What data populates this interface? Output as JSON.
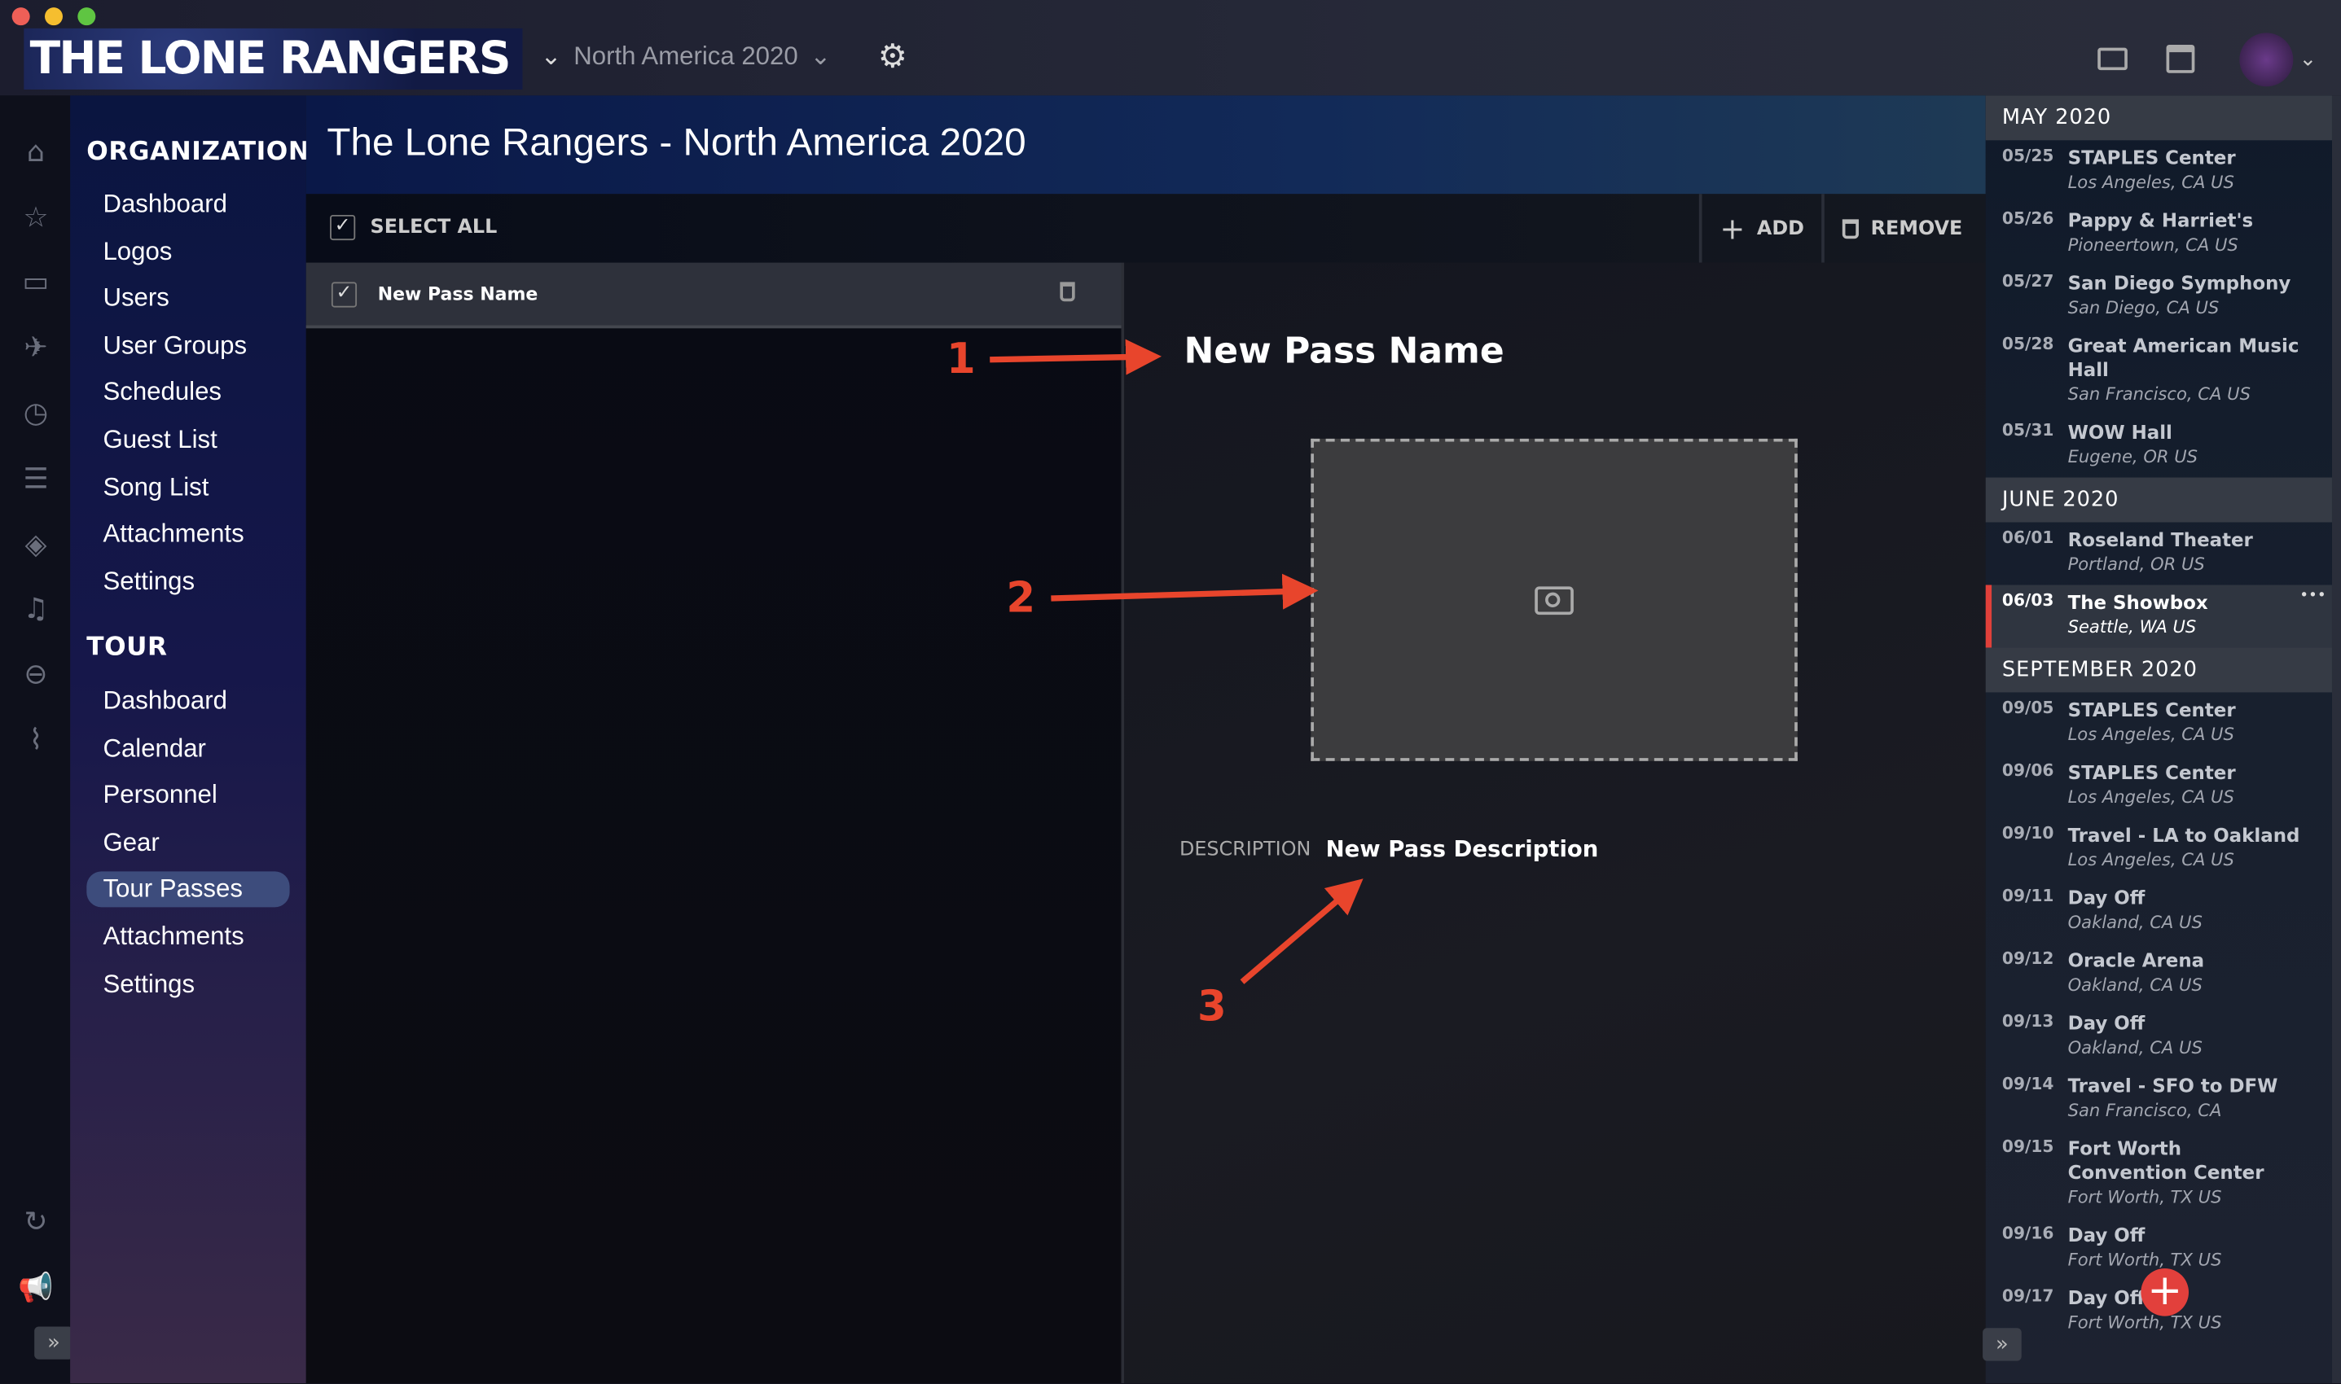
{
  "window": {
    "controls": [
      "close",
      "minimize",
      "zoom"
    ]
  },
  "topbar": {
    "logo_text": "THE LONE RANGERS",
    "tour_selector": "North America 2020",
    "icons": [
      "chevron-down-icon",
      "gear-icon",
      "contact-card-icon",
      "calendar-icon",
      "avatar"
    ]
  },
  "rail": {
    "icons": [
      "home-icon",
      "star-icon",
      "briefcase-icon",
      "plane-icon",
      "clock-icon",
      "list-icon",
      "ticket-icon",
      "music-icon",
      "piggy-bank-icon",
      "paperclip-icon",
      "sync-icon",
      "megaphone-icon"
    ],
    "expand": "»"
  },
  "nav": {
    "organization_heading": "ORGANIZATION",
    "organization": [
      {
        "label": "Dashboard"
      },
      {
        "label": "Logos"
      },
      {
        "label": "Users"
      },
      {
        "label": "User Groups"
      },
      {
        "label": "Schedules"
      },
      {
        "label": "Guest List"
      },
      {
        "label": "Song List"
      },
      {
        "label": "Attachments"
      },
      {
        "label": "Settings"
      }
    ],
    "tour_heading": "TOUR",
    "tour": [
      {
        "label": "Dashboard"
      },
      {
        "label": "Calendar"
      },
      {
        "label": "Personnel"
      },
      {
        "label": "Gear"
      },
      {
        "label": "Tour Passes",
        "selected": true
      },
      {
        "label": "Attachments"
      },
      {
        "label": "Settings"
      }
    ]
  },
  "header": {
    "title": "The Lone Rangers - North America 2020"
  },
  "toolbar": {
    "select_all": "SELECT ALL",
    "add": "ADD",
    "remove": "REMOVE",
    "select_all_checked": true
  },
  "passes": [
    {
      "name": "New Pass Name",
      "checked": true
    }
  ],
  "detail": {
    "name": "New Pass Name",
    "description_label": "DESCRIPTION",
    "description": "New Pass Description"
  },
  "annotations": {
    "color": "#e8452c",
    "labels": [
      "1",
      "2",
      "3"
    ]
  },
  "schedule": {
    "accent": "#e0403a",
    "months": [
      {
        "label": "MAY 2020",
        "events": [
          {
            "date": "05/25",
            "name": "STAPLES Center",
            "location": "Los Angeles, CA US"
          },
          {
            "date": "05/26",
            "name": "Pappy & Harriet's",
            "location": "Pioneertown, CA US"
          },
          {
            "date": "05/27",
            "name": "San Diego Symphony",
            "location": "San Diego, CA US"
          },
          {
            "date": "05/28",
            "name": "Great American Music Hall",
            "location": "San Francisco, CA US"
          },
          {
            "date": "05/31",
            "name": "WOW Hall",
            "location": "Eugene, OR US"
          }
        ]
      },
      {
        "label": "JUNE 2020",
        "events": [
          {
            "date": "06/01",
            "name": "Roseland Theater",
            "location": "Portland, OR US"
          },
          {
            "date": "06/03",
            "name": "The Showbox",
            "location": "Seattle, WA US",
            "selected": true,
            "more": "•••"
          }
        ]
      },
      {
        "label": "SEPTEMBER 2020",
        "events": [
          {
            "date": "09/05",
            "name": "STAPLES Center",
            "location": "Los Angeles, CA US"
          },
          {
            "date": "09/06",
            "name": "STAPLES Center",
            "location": "Los Angeles, CA US"
          },
          {
            "date": "09/10",
            "name": "Travel - LA to Oakland",
            "location": "Los Angeles, CA US"
          },
          {
            "date": "09/11",
            "name": "Day Off",
            "location": "Oakland, CA US"
          },
          {
            "date": "09/12",
            "name": "Oracle Arena",
            "location": "Oakland, CA US"
          },
          {
            "date": "09/13",
            "name": "Day Off",
            "location": "Oakland, CA US"
          },
          {
            "date": "09/14",
            "name": "Travel - SFO to DFW",
            "location": "San Francisco, CA"
          },
          {
            "date": "09/15",
            "name": "Fort Worth Convention Center",
            "location": "Fort Worth, TX US"
          },
          {
            "date": "09/16",
            "name": "Day Off",
            "location": "Fort Worth, TX US"
          },
          {
            "date": "09/17",
            "name": "Day Off",
            "location": "Fort Worth, TX US"
          }
        ]
      }
    ],
    "add_label": "+"
  }
}
